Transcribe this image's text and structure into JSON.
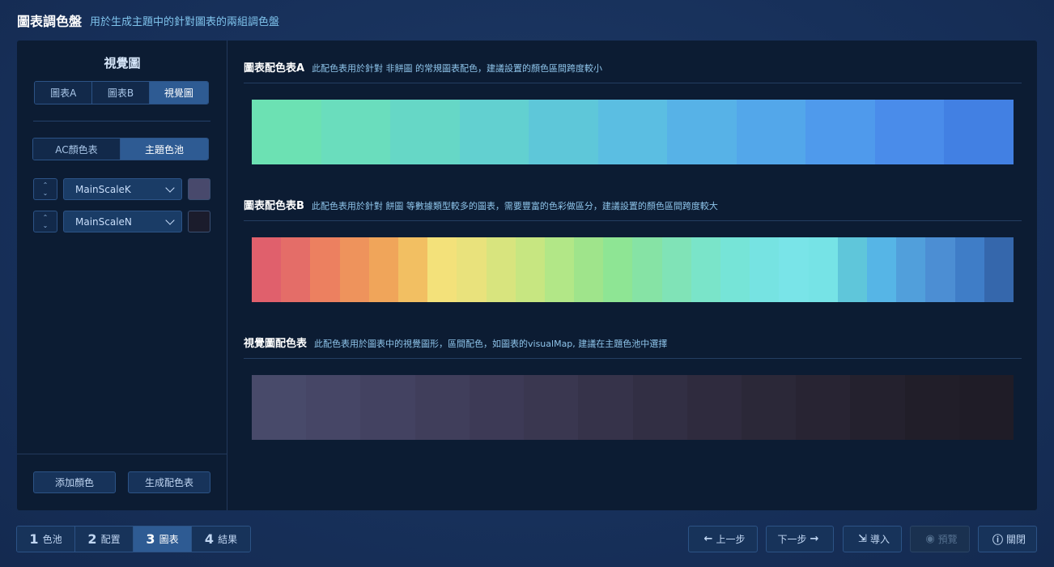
{
  "app": {
    "title": "圖表調色盤",
    "subtitle": "用於生成主題中的針對圖表的兩組調色盤"
  },
  "left": {
    "title": "視覺圖",
    "tabs": [
      "圖表A",
      "圖表B",
      "視覺圖"
    ],
    "active_tab": 2,
    "modes": [
      "AC顏色表",
      "主題色池"
    ],
    "active_mode": 1,
    "scales": [
      {
        "name": "MainScaleK",
        "color": "#48496c"
      },
      {
        "name": "MainScaleN",
        "color": "#1b1c2c"
      }
    ],
    "add_color_label": "添加顏色",
    "generate_label": "生成配色表"
  },
  "sections": [
    {
      "title": "圖表配色表A",
      "desc": "此配色表用於針對 非餅圖 的常規圖表配色，建議設置的顏色區間跨度較小",
      "colors": [
        "#6ce1b3",
        "#6addbd",
        "#66d7c6",
        "#62d0d0",
        "#5ec7d9",
        "#5bbee2",
        "#57b2e7",
        "#53a7ea",
        "#4f9aec",
        "#4a8cea",
        "#4280e3"
      ]
    },
    {
      "title": "圖表配色表B",
      "desc": "此配色表用於針對 餅圖 等數據類型較多的圖表，需要豐富的色彩做區分，建議設置的顏色區間跨度較大",
      "colors": [
        "#e0606c",
        "#e46d68",
        "#ec8060",
        "#ee935c",
        "#f0a55a",
        "#f2bf62",
        "#f3e17a",
        "#e9e27c",
        "#d8e47e",
        "#c7e681",
        "#b2e787",
        "#9fe48b",
        "#8ee594",
        "#86e3a5",
        "#80e3b7",
        "#7ae4c9",
        "#76e4d7",
        "#76e3e2",
        "#79e4e8",
        "#76e3e6",
        "#5fc6da",
        "#56b5e6",
        "#519fdb",
        "#4c8ed3",
        "#3f7dc7",
        "#3567ac"
      ]
    },
    {
      "title": "視覺圖配色表",
      "desc": "此配色表用於圖表中的視覺圖形，區間配色，如圖表的visualMap, 建議在主題色池中選擇",
      "colors": [
        "#484a6a",
        "#464666",
        "#434261",
        "#403e5b",
        "#3d3a56",
        "#3a3750",
        "#36334a",
        "#322f44",
        "#2f2b3e",
        "#2b2838",
        "#282433",
        "#24212e",
        "#211e29",
        "#1f1c27"
      ]
    }
  ],
  "footer": {
    "steps": [
      {
        "num": "1",
        "label": "色池"
      },
      {
        "num": "2",
        "label": "配置"
      },
      {
        "num": "3",
        "label": "圖表"
      },
      {
        "num": "4",
        "label": "結果"
      }
    ],
    "active_step": 2,
    "prev_label": "上一步",
    "next_label": "下一步",
    "import_label": "導入",
    "preview_label": "預覽",
    "close_label": "關閉"
  }
}
